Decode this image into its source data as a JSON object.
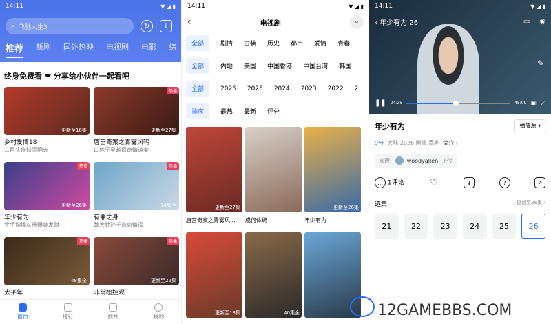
{
  "status": {
    "time": "14:11"
  },
  "home": {
    "search_placeholder": "飞驰人生3",
    "tabs": [
      "推荐",
      "新剧",
      "国外热映",
      "电视剧",
      "电影",
      "综"
    ],
    "banner": "终身免费看 ❤ 分享给小伙伴一起看吧",
    "cards": [
      {
        "title": "乡村爱情18",
        "sub": "三巨头作妖闹翻天",
        "ep": "更新至18集",
        "hot": "",
        "c1": "#b33a2a",
        "c2": "#5a2a20"
      },
      {
        "title": "唐宫奇案之青雾风鸣",
        "sub": "白鹿王星越探奇情谈案",
        "ep": "更新至27集",
        "hot": "热播",
        "c1": "#8c3a2a",
        "c2": "#3a1a16"
      },
      {
        "title": "年少有为",
        "sub": "金手指撬贫畅爆爽发财",
        "ep": "更新至26集",
        "hot": "热播",
        "c1": "#3a3f8a",
        "c2": "#d04aa0"
      },
      {
        "title": "有罪之身",
        "sub": "魏大勋孙千密恋情深",
        "ep": "14集全",
        "hot": "热播",
        "c1": "#6fa5c8",
        "c2": "#c9d9e6"
      },
      {
        "title": "太平年",
        "sub": "",
        "ep": "48集全",
        "hot": "热播",
        "c1": "#3a2a1a",
        "c2": "#7a5a3a"
      },
      {
        "title": "非常检控观",
        "sub": "",
        "ep": "更新至22集",
        "hot": "热播",
        "c1": "#8a4a3a",
        "c2": "#3a2a2a"
      }
    ],
    "nav": [
      "首页",
      "排行",
      "找片",
      "我的"
    ]
  },
  "list": {
    "title": "电视剧",
    "rows": [
      [
        "全部",
        "剧情",
        "古装",
        "历史",
        "都市",
        "爱情",
        "青春"
      ],
      [
        "全部",
        "内地",
        "美国",
        "中国香港",
        "中国台湾",
        "韩国"
      ],
      [
        "全部",
        "2026",
        "2025",
        "2024",
        "2023",
        "2022",
        "2"
      ],
      [
        "排序",
        "最热",
        "最新",
        "评分"
      ]
    ],
    "posters": [
      {
        "title": "唐宫奇案之青雾风...",
        "ep": "更新至27集",
        "c1": "#c0463a",
        "c2": "#6a2a22"
      },
      {
        "title": "成何体统",
        "ep": "",
        "c1": "#d8d0c8",
        "c2": "#8a6a5a"
      },
      {
        "title": "年少有为",
        "ep": "更新至26集",
        "c1": "#e8b048",
        "c2": "#3a6aa8"
      },
      {
        "title": "",
        "ep": "更新至18集",
        "c1": "#d84a3a",
        "c2": "#6a3a2a"
      },
      {
        "title": "",
        "ep": "40集全",
        "c1": "#8a6a4a",
        "c2": "#2a2a2a"
      },
      {
        "title": "",
        "ep": "",
        "c1": "#6aa8d8",
        "c2": "#2a3a4a"
      }
    ]
  },
  "player": {
    "video_title": "年少有为 26",
    "time_cur": "24:25",
    "time_total": "45:09",
    "title": "年少有为",
    "source_btn": "播放源",
    "score": "9分",
    "meta": "大陆 2026 剧情,喜剧",
    "intro": "简介",
    "uploader_label": "来源:",
    "uploader": "woodyallen",
    "upload_word": "上传",
    "comments": "1评论",
    "select_label": "选集",
    "update": "更新至26集",
    "episodes": [
      "21",
      "22",
      "23",
      "24",
      "25",
      "26"
    ]
  },
  "watermark": "12GAMEBBS.COM"
}
